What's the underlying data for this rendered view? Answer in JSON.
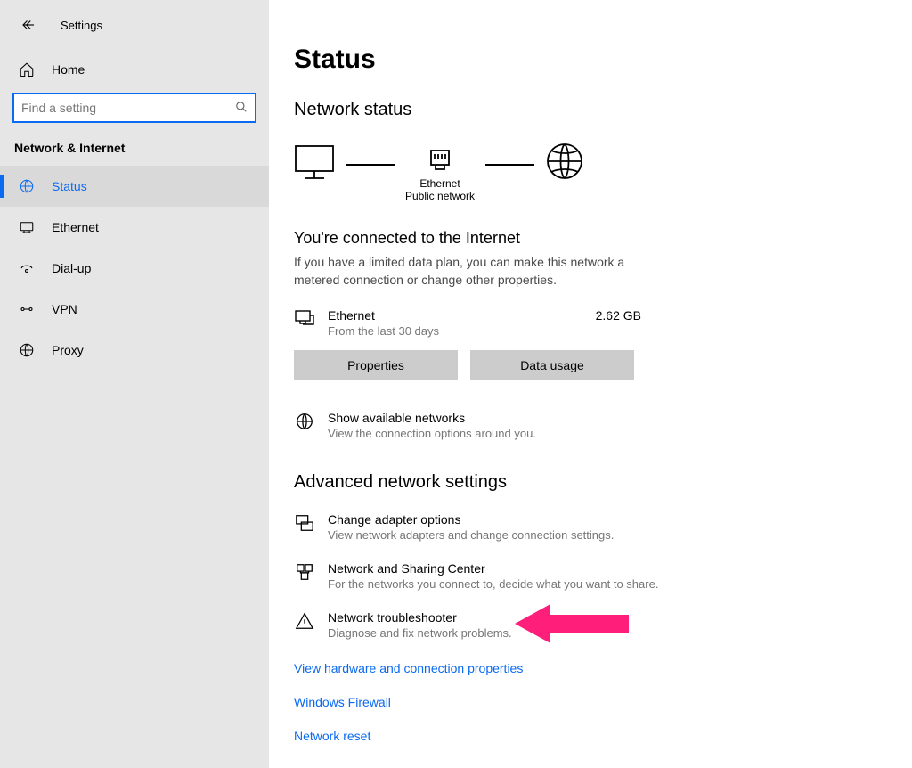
{
  "app": {
    "title": "Settings"
  },
  "sidebar": {
    "home": "Home",
    "search_placeholder": "Find a setting",
    "category": "Network & Internet",
    "items": [
      {
        "label": "Status"
      },
      {
        "label": "Ethernet"
      },
      {
        "label": "Dial-up"
      },
      {
        "label": "VPN"
      },
      {
        "label": "Proxy"
      }
    ]
  },
  "main": {
    "title": "Status",
    "network_status_h": "Network status",
    "diagram": {
      "nic_label": "Ethernet",
      "nic_sub": "Public network"
    },
    "connected_h": "You're connected to the Internet",
    "connected_sub": "If you have a limited data plan, you can make this network a metered connection or change other properties.",
    "adapter": {
      "name": "Ethernet",
      "sub": "From the last 30 days",
      "usage": "2.62 GB"
    },
    "buttons": {
      "properties": "Properties",
      "data_usage": "Data usage"
    },
    "show_networks": {
      "title": "Show available networks",
      "sub": "View the connection options around you."
    },
    "advanced_h": "Advanced network settings",
    "adv_items": [
      {
        "title": "Change adapter options",
        "sub": "View network adapters and change connection settings."
      },
      {
        "title": "Network and Sharing Center",
        "sub": "For the networks you connect to, decide what you want to share."
      },
      {
        "title": "Network troubleshooter",
        "sub": "Diagnose and fix network problems."
      }
    ],
    "links": [
      "View hardware and connection properties",
      "Windows Firewall",
      "Network reset"
    ]
  }
}
